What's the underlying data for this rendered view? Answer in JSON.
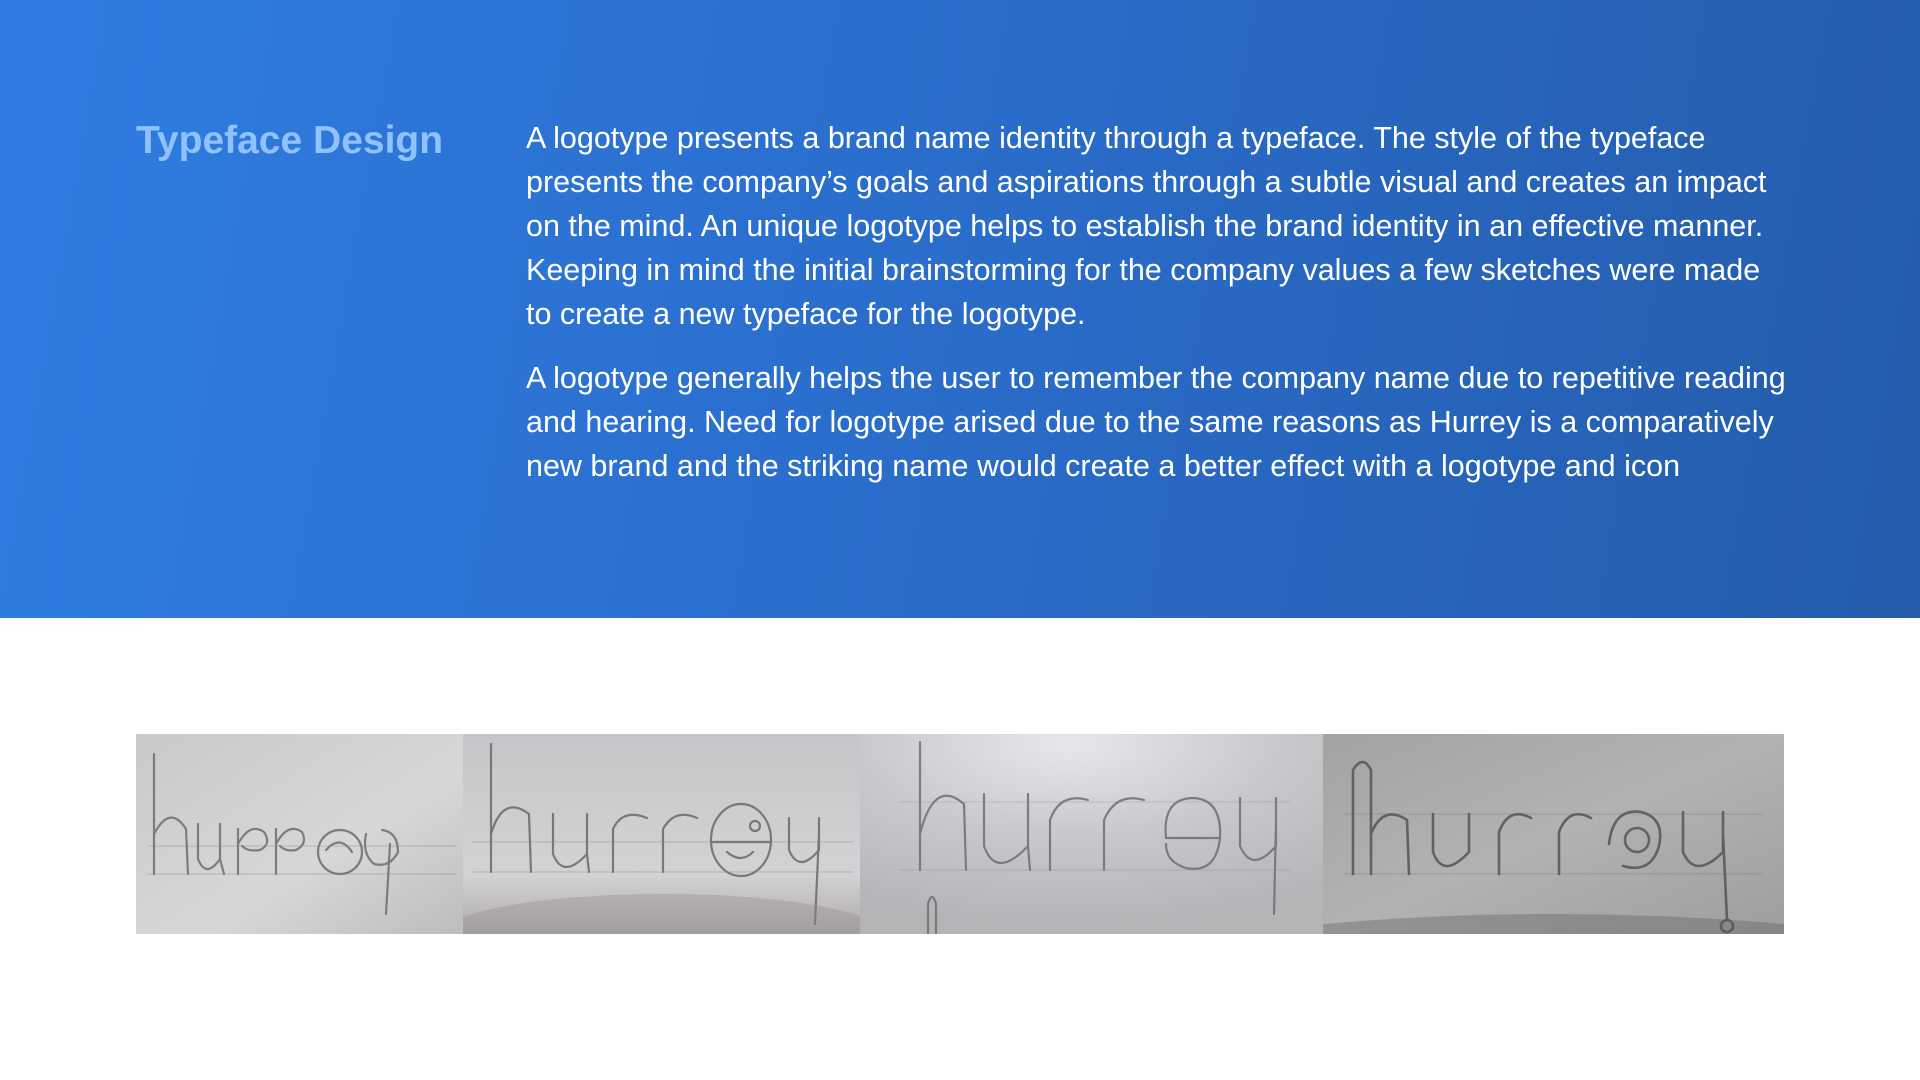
{
  "section": {
    "title": "Typeface Design",
    "paragraphs": [
      "A logotype presents a brand name identity through a typeface. The style of the typeface presents the company’s goals and aspirations through a subtle visual and creates an impact on the mind. An unique logotype helps to establish the brand identity in an effective manner. Keeping in mind the initial brainstorming for the company values a few sketches were made to create a new typeface for the logotype.",
      "A logotype generally helps the user to remember the company name due to repetitive reading and hearing. Need for logotype arised due to the same reasons as Hurrey is a comparatively new brand and the striking name would create a better effect with a logotype and icon"
    ]
  },
  "sketches": [
    {
      "name": "sketch-1",
      "word": "hurrey"
    },
    {
      "name": "sketch-2",
      "word": "hurrey"
    },
    {
      "name": "sketch-3",
      "word": "hurrey"
    },
    {
      "name": "sketch-4",
      "word": "hurrey"
    }
  ],
  "colors": {
    "hero_start": "#2f7de1",
    "hero_end": "#245cab",
    "title": "#8fc2ff",
    "body_text": "#ffffff",
    "pencil": "#6b6b6b"
  }
}
